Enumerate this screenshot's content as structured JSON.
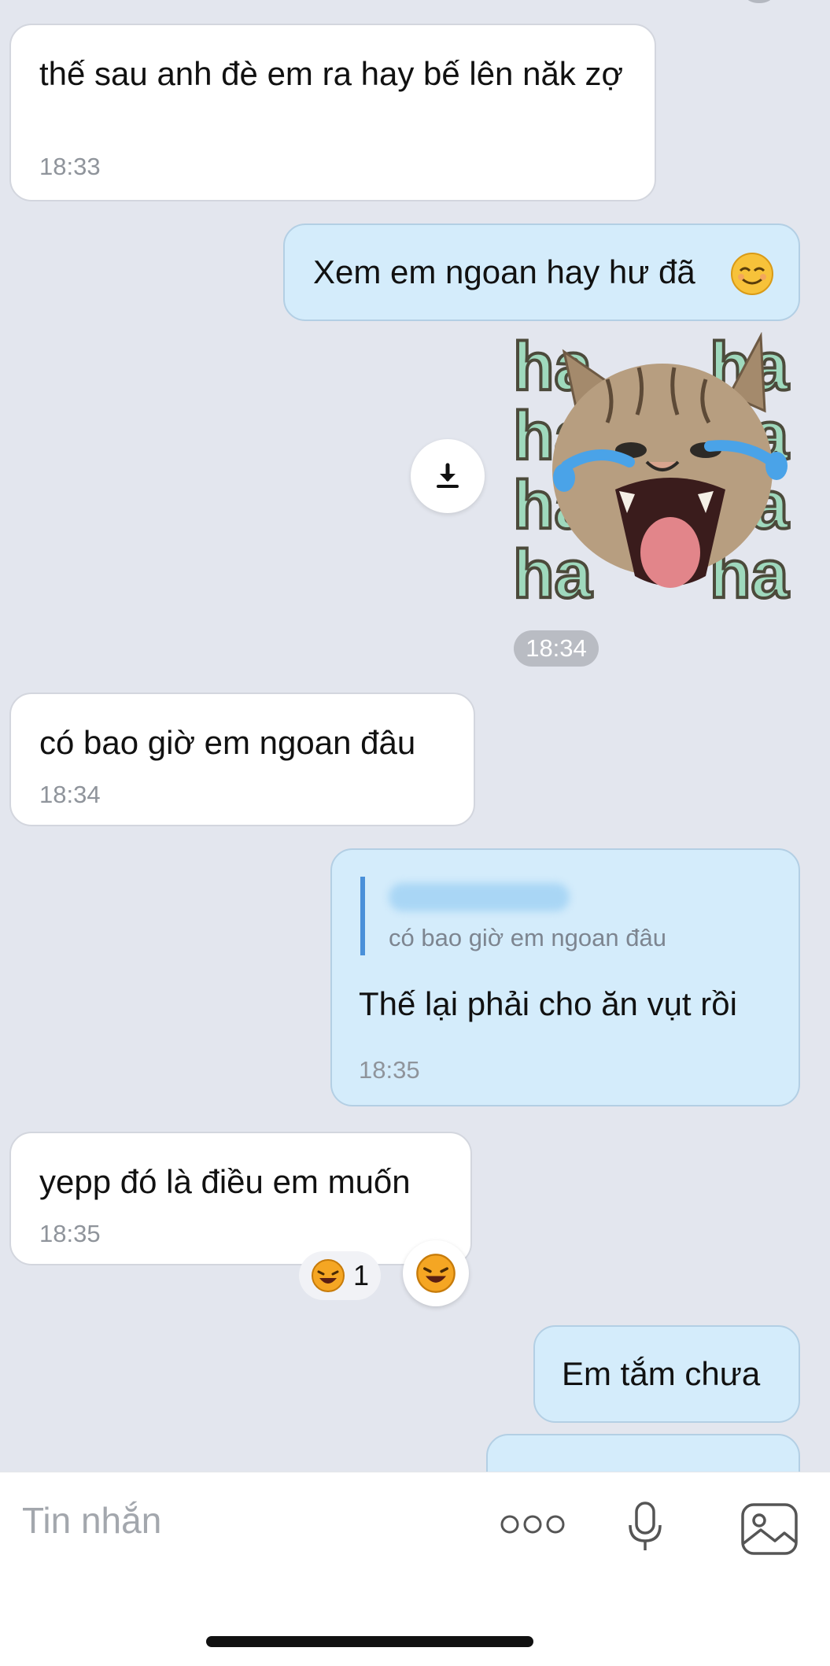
{
  "messages": [
    {
      "text": "thế sau anh đè em ra hay bế lên năk zợ",
      "time": "18:33"
    },
    {
      "text": "Xem em ngoan hay hư đã"
    },
    {
      "time": "18:34"
    },
    {
      "text": "có bao giờ em ngoan đâu",
      "time": "18:34"
    },
    {
      "quote": "có bao giờ em ngoan đâu",
      "text": "Thế lại phải cho ăn vụt rồi",
      "time": "18:35"
    },
    {
      "text": "yepp đó là điều em muốn",
      "time": "18:35",
      "reaction_count": "1"
    },
    {
      "text": "Em tắm chưa"
    }
  ],
  "sticker": {
    "label": "ha",
    "icons": [
      "cat-sticker",
      "download-icon"
    ]
  },
  "input": {
    "placeholder": "Tin nhắn",
    "icons": [
      "more-icon",
      "microphone-icon",
      "image-icon"
    ]
  },
  "colors": {
    "background": "#e3e6ee",
    "incoming_bubble": "#ffffff",
    "outgoing_bubble": "#d4ecfb",
    "quote_bar": "#4a90d9"
  }
}
